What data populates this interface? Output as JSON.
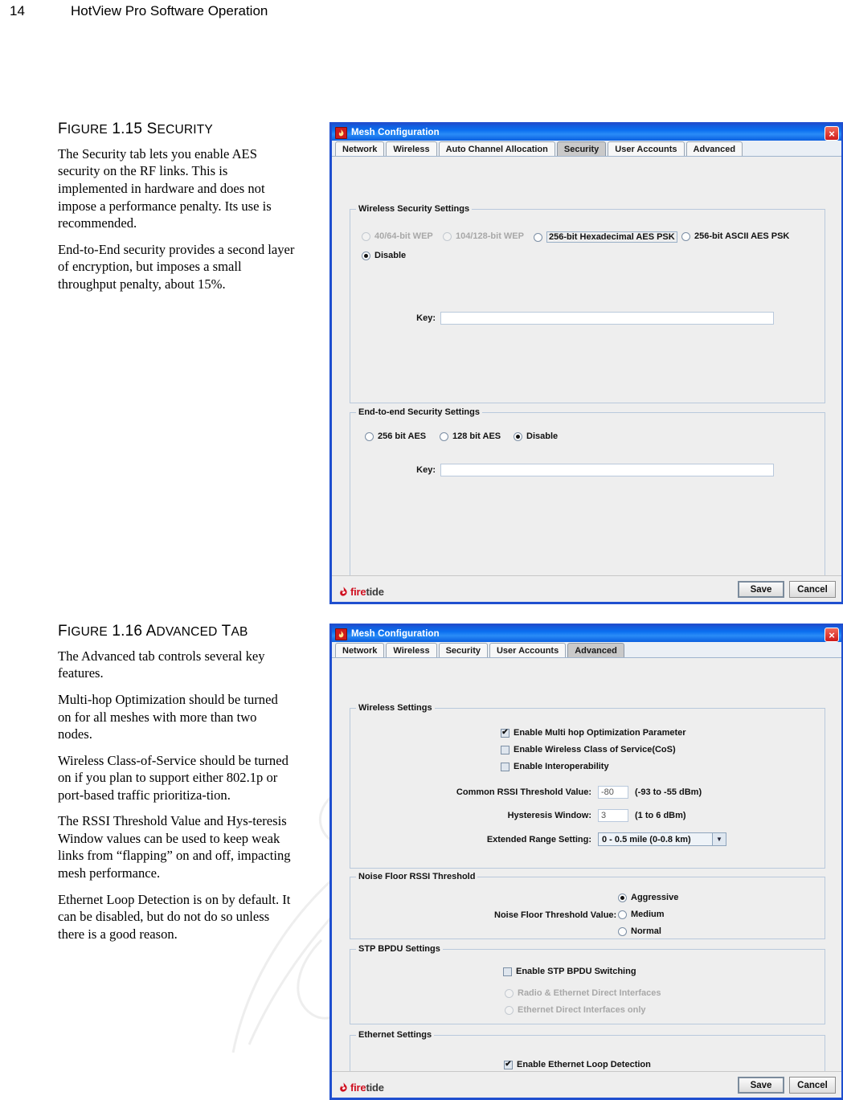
{
  "page": {
    "number": "14",
    "running_title": "HotView Pro Software Operation"
  },
  "figure_1_15": {
    "heading_prefix": "F",
    "heading": "IGURE 1.15 S",
    "heading_tail": "ECURITY",
    "heading_full": "FIGURE 1.15 SECURITY",
    "paragraphs": [
      "The Security tab lets you enable AES security on the RF links. This is implemented in hardware and does not impose a performance penalty. Its use is recommended.",
      "End-to-End security provides a second layer of encryption, but imposes a small throughput penalty, about 15%."
    ]
  },
  "figure_1_16": {
    "heading_full": "FIGURE 1.16 ADVANCED TAB",
    "paragraphs": [
      "The Advanced tab controls several key features.",
      "Multi-hop Optimization should be turned on for all meshes with more than two nodes.",
      "Wireless Class-of-Service should be turned on if you plan to support either 802.1p or port-based traffic prioritiza-tion.",
      "The RSSI Threshold Value and Hys-teresis Window values can be used to keep weak links from “flapping” on and off, impacting mesh performance.",
      "Ethernet Loop Detection is on by default. It can be disabled, but do not do so unless there is a good reason."
    ]
  },
  "security_dialog": {
    "title": "Mesh Configuration",
    "close_label": "×",
    "tabs": [
      {
        "label": "Network",
        "selected": false
      },
      {
        "label": "Wireless",
        "selected": false
      },
      {
        "label": "Auto Channel Allocation",
        "selected": false
      },
      {
        "label": "Security",
        "selected": true
      },
      {
        "label": "User Accounts",
        "selected": false
      },
      {
        "label": "Advanced",
        "selected": false
      }
    ],
    "wireless_security": {
      "group_label": "Wireless Security Settings",
      "options": [
        {
          "label": "40/64-bit WEP",
          "selected": false,
          "disabled": true
        },
        {
          "label": "104/128-bit WEP",
          "selected": false,
          "disabled": true
        },
        {
          "label": "256-bit Hexadecimal AES PSK",
          "selected": false,
          "disabled": false,
          "focused": true
        },
        {
          "label": "256-bit ASCII AES PSK",
          "selected": false,
          "disabled": false
        },
        {
          "label": "Disable",
          "selected": true,
          "disabled": false
        }
      ],
      "key_label": "Key:",
      "key_value": ""
    },
    "end_to_end_security": {
      "group_label": "End-to-end Security Settings",
      "options": [
        {
          "label": "256 bit AES",
          "selected": false
        },
        {
          "label": "128 bit AES",
          "selected": false
        },
        {
          "label": "Disable",
          "selected": true
        }
      ],
      "key_label": "Key:",
      "key_value": ""
    },
    "footer": {
      "logo_part1": "fire",
      "logo_part2": "tide",
      "save_label": "Save",
      "cancel_label": "Cancel"
    }
  },
  "advanced_dialog": {
    "title": "Mesh Configuration",
    "close_label": "×",
    "tabs": [
      {
        "label": "Network",
        "selected": false
      },
      {
        "label": "Wireless",
        "selected": false
      },
      {
        "label": "Security",
        "selected": false
      },
      {
        "label": "User Accounts",
        "selected": false
      },
      {
        "label": "Advanced",
        "selected": true
      }
    ],
    "wireless_settings": {
      "group_label": "Wireless Settings",
      "checkboxes": [
        {
          "label": "Enable Multi hop Optimization Parameter",
          "checked": true
        },
        {
          "label": "Enable Wireless Class of Service(CoS)",
          "checked": false
        },
        {
          "label": "Enable Interoperability",
          "checked": false
        }
      ],
      "fields": [
        {
          "label": "Common RSSI Threshold Value:",
          "value": "-80",
          "hint": "(-93 to -55 dBm)"
        },
        {
          "label": "Hysteresis Window:",
          "value": "3",
          "hint": "(1 to 6 dBm)"
        }
      ],
      "extended_range": {
        "label": "Extended Range Setting:",
        "value": "0 - 0.5 mile (0-0.8 km)",
        "arrow": "▼"
      }
    },
    "noise_floor": {
      "group_label": "Noise Floor RSSI Threshold",
      "field_label": "Noise Floor Threshold Value:",
      "options": [
        {
          "label": "Aggressive",
          "selected": true
        },
        {
          "label": "Medium",
          "selected": false
        },
        {
          "label": "Normal",
          "selected": false
        }
      ]
    },
    "stp_bpdu": {
      "group_label": "STP BPDU Settings",
      "checkbox": {
        "label": "Enable STP BPDU Switching",
        "checked": false
      },
      "options": [
        {
          "label": "Radio & Ethernet Direct Interfaces",
          "selected": false,
          "disabled": true
        },
        {
          "label": "Ethernet Direct Interfaces only",
          "selected": false,
          "disabled": true
        }
      ]
    },
    "ethernet_settings": {
      "group_label": "Ethernet Settings",
      "checkbox": {
        "label": "Enable Ethernet Loop Detection",
        "checked": true
      }
    },
    "footer": {
      "logo_part1": "fire",
      "logo_part2": "tide",
      "save_label": "Save",
      "cancel_label": "Cancel"
    }
  },
  "colors": {
    "titlebar_blue": "#0b6ff0",
    "dialog_border": "#1f4fcf",
    "panel_gray": "#eeeeee",
    "logo_red": "#cf1020",
    "selected_tab": "#c9c9c9"
  }
}
